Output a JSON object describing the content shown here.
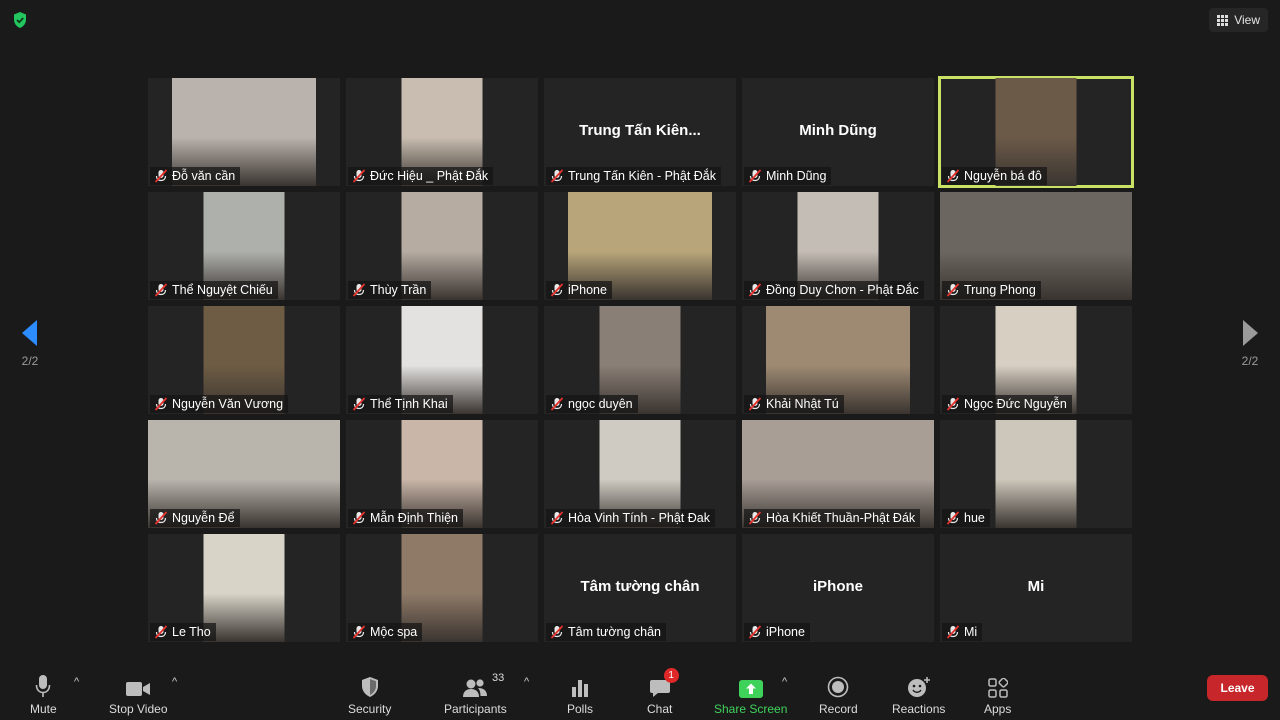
{
  "top_bar": {
    "view_label": "View"
  },
  "pager": {
    "left_page": "2/2",
    "right_page": "2/2"
  },
  "tiles": [
    {
      "name": "Đỗ văn cần",
      "video": true,
      "bg": "#b9b2ad"
    },
    {
      "name": "Đức Hiệu _ Phật Đắk",
      "video": true,
      "bg": "#c8bdb0"
    },
    {
      "name": "Trung Tấn Kiên - Phật Đắk",
      "big": "Trung Tấn Kiên...",
      "video": false
    },
    {
      "name": "Minh Dũng",
      "big": "Minh Dũng",
      "video": false
    },
    {
      "name": "Nguyễn bá đô",
      "video": true,
      "bg": "#6b5a48",
      "active": true
    },
    {
      "name": "Thể Nguyệt Chiếu",
      "video": true,
      "bg": "#aeb0ac"
    },
    {
      "name": "Thùy Trần",
      "video": true,
      "bg": "#b6aca2"
    },
    {
      "name": "iPhone",
      "video": true,
      "bg": "#b8a579"
    },
    {
      "name": "Đồng Duy Chơn - Phật Đắc",
      "video": true,
      "bg": "#c4bdb5"
    },
    {
      "name": "Trung Phong",
      "video": true,
      "bg": "#6b665f"
    },
    {
      "name": "Nguyễn Văn Vương",
      "video": true,
      "bg": "#6e5c44"
    },
    {
      "name": "Thể Tịnh Khai",
      "video": true,
      "bg": "#e3e2e0"
    },
    {
      "name": "ngọc duyên",
      "video": true,
      "bg": "#8a7f76"
    },
    {
      "name": "Khải Nhật Tú",
      "video": true,
      "bg": "#9e8a73"
    },
    {
      "name": "Ngọc Đức Nguyễn",
      "video": true,
      "bg": "#d7cfc2"
    },
    {
      "name": "Nguyễn Để",
      "video": true,
      "bg": "#b9b4ac"
    },
    {
      "name": "Mẫn Định Thiện",
      "video": true,
      "bg": "#c9b6a8"
    },
    {
      "name": "Hòa Vinh Tính - Phật Đak",
      "video": true,
      "bg": "#cfcbc2"
    },
    {
      "name": "Hòa Khiết Thuần-Phật Đák",
      "video": true,
      "bg": "#a89e96"
    },
    {
      "name": "hue",
      "video": true,
      "bg": "#cdc6bb"
    },
    {
      "name": "Le Tho",
      "video": true,
      "bg": "#d8d4c8"
    },
    {
      "name": "Mộc spa",
      "video": true,
      "bg": "#8f7a68"
    },
    {
      "name": "Tâm tường chân",
      "big": "Tâm tường chân",
      "video": false
    },
    {
      "name": "iPhone",
      "big": "iPhone",
      "video": false
    },
    {
      "name": "Mi",
      "big": "Mi",
      "video": false
    }
  ],
  "toolbar": {
    "mute": "Mute",
    "stop_video": "Stop Video",
    "security": "Security",
    "participants": "Participants",
    "participants_count": "33",
    "polls": "Polls",
    "chat": "Chat",
    "chat_badge": "1",
    "share_screen": "Share Screen",
    "record": "Record",
    "reactions": "Reactions",
    "apps": "Apps",
    "leave": "Leave"
  },
  "colors": {
    "accent_active": "#c9e265",
    "share_green": "#3fd25b",
    "leave_red": "#c7262a",
    "nav_blue": "#2d8cff"
  }
}
